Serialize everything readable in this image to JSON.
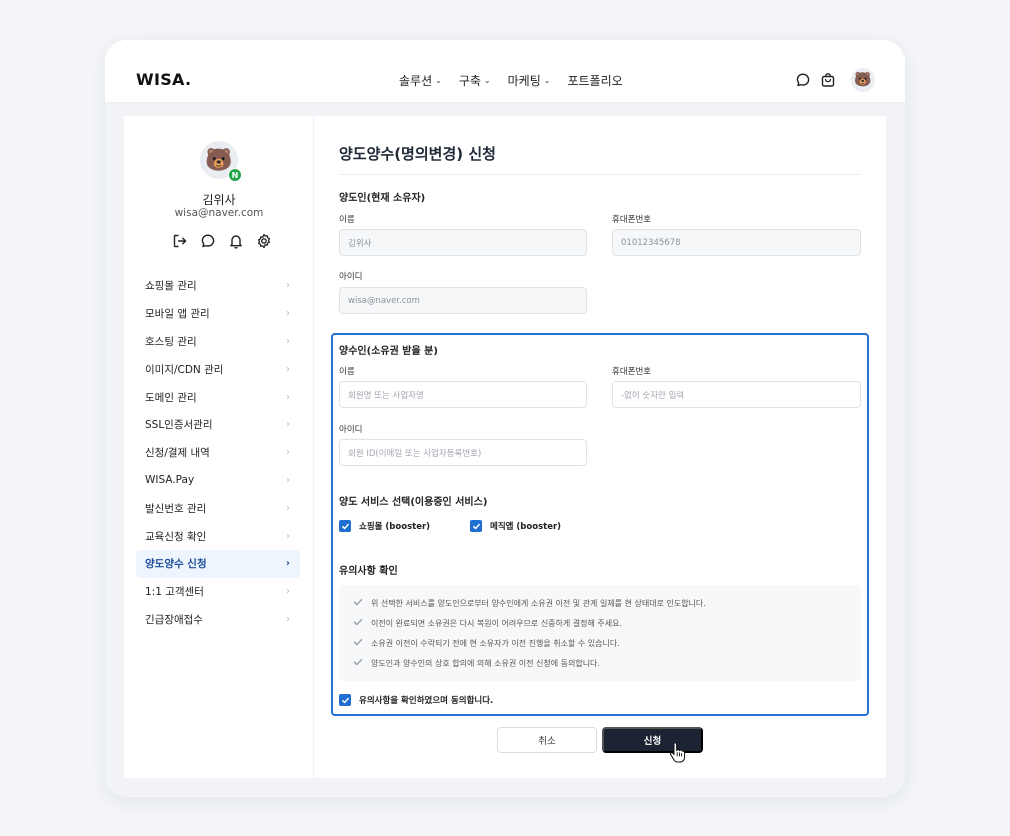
{
  "header": {
    "logo": "WISA.",
    "nav": [
      {
        "label": "솔루션",
        "has_dropdown": true
      },
      {
        "label": "구축",
        "has_dropdown": true
      },
      {
        "label": "마케팅",
        "has_dropdown": true
      },
      {
        "label": "포트폴리오",
        "has_dropdown": false
      }
    ],
    "icons": [
      "chat-icon",
      "cart-icon",
      "bear-avatar"
    ]
  },
  "profile": {
    "name": "김위사",
    "email": "wisa@naver.com",
    "badge": "N",
    "badge_color": "#22a54a",
    "icons": [
      "logout-icon",
      "chat-icon",
      "bell-icon",
      "gear-icon"
    ]
  },
  "sidebar": {
    "items": [
      {
        "label": "쇼핑몰 관리",
        "active": false
      },
      {
        "label": "모바일 앱 관리",
        "active": false
      },
      {
        "label": "호스팅 관리",
        "active": false
      },
      {
        "label": "이미지/CDN 관리",
        "active": false
      },
      {
        "label": "도메인 관리",
        "active": false
      },
      {
        "label": "SSL인증서관리",
        "active": false
      },
      {
        "label": "신청/결제 내역",
        "active": false
      },
      {
        "label": "WISA.Pay",
        "active": false
      },
      {
        "label": "발신번호 관리",
        "active": false
      },
      {
        "label": "교육신청 확인",
        "active": false
      },
      {
        "label": "양도양수 신청",
        "active": true
      },
      {
        "label": "1:1 고객센터",
        "active": false
      },
      {
        "label": "긴급장애접수",
        "active": false
      }
    ]
  },
  "main": {
    "title": "양도양수(명의변경) 신청",
    "transferor": {
      "heading": "양도인(현재 소유자)",
      "name_label": "이름",
      "name_value": "김위사",
      "phone_label": "휴대폰번호",
      "phone_value": "01012345678",
      "id_label": "아이디",
      "id_value": "wisa@naver.com"
    },
    "transferee": {
      "heading": "양수인(소유권 받을 분)",
      "name_label": "이름",
      "name_placeholder": "회원명 또는 사업자명",
      "phone_label": "휴대폰번호",
      "phone_placeholder": "-없이 숫자만 입력",
      "id_label": "아이디",
      "id_placeholder": "회원 ID(이메일 또는 사업자등록번호)"
    },
    "services": {
      "heading": "양도 서비스 선택(이용중인 서비스)",
      "items": [
        {
          "label": "쇼핑몰 (booster)",
          "checked": true
        },
        {
          "label": "메직앱 (booster)",
          "checked": true
        }
      ]
    },
    "notice": {
      "heading": "유의사항 확인",
      "items": [
        "위 선택한 서비스를 양도인으로부터 양수인에게 소유권 이전 및 관계 일체를 현 상태대로 인도합니다.",
        "이전이 완료되면 소유권은 다시 복원이 어려우므로 신중하게 결정해 주세요.",
        "소유권 이전이 수락되기 전에 현 소유자가 이전 진행을 취소할 수 있습니다.",
        "양도인과 양수인의 상호 합의에 의해 소유권 이전 신청에 동의합니다."
      ],
      "agree_label": "유의사항을 확인하였으며 동의합니다.",
      "agree_checked": true
    },
    "buttons": {
      "cancel": "취소",
      "submit": "신청"
    }
  },
  "colors": {
    "accent": "#1f6fd1",
    "highlight_border": "#2473d4",
    "submit_bg": "#1c2433",
    "active_menu_bg": "#eff5fd"
  }
}
